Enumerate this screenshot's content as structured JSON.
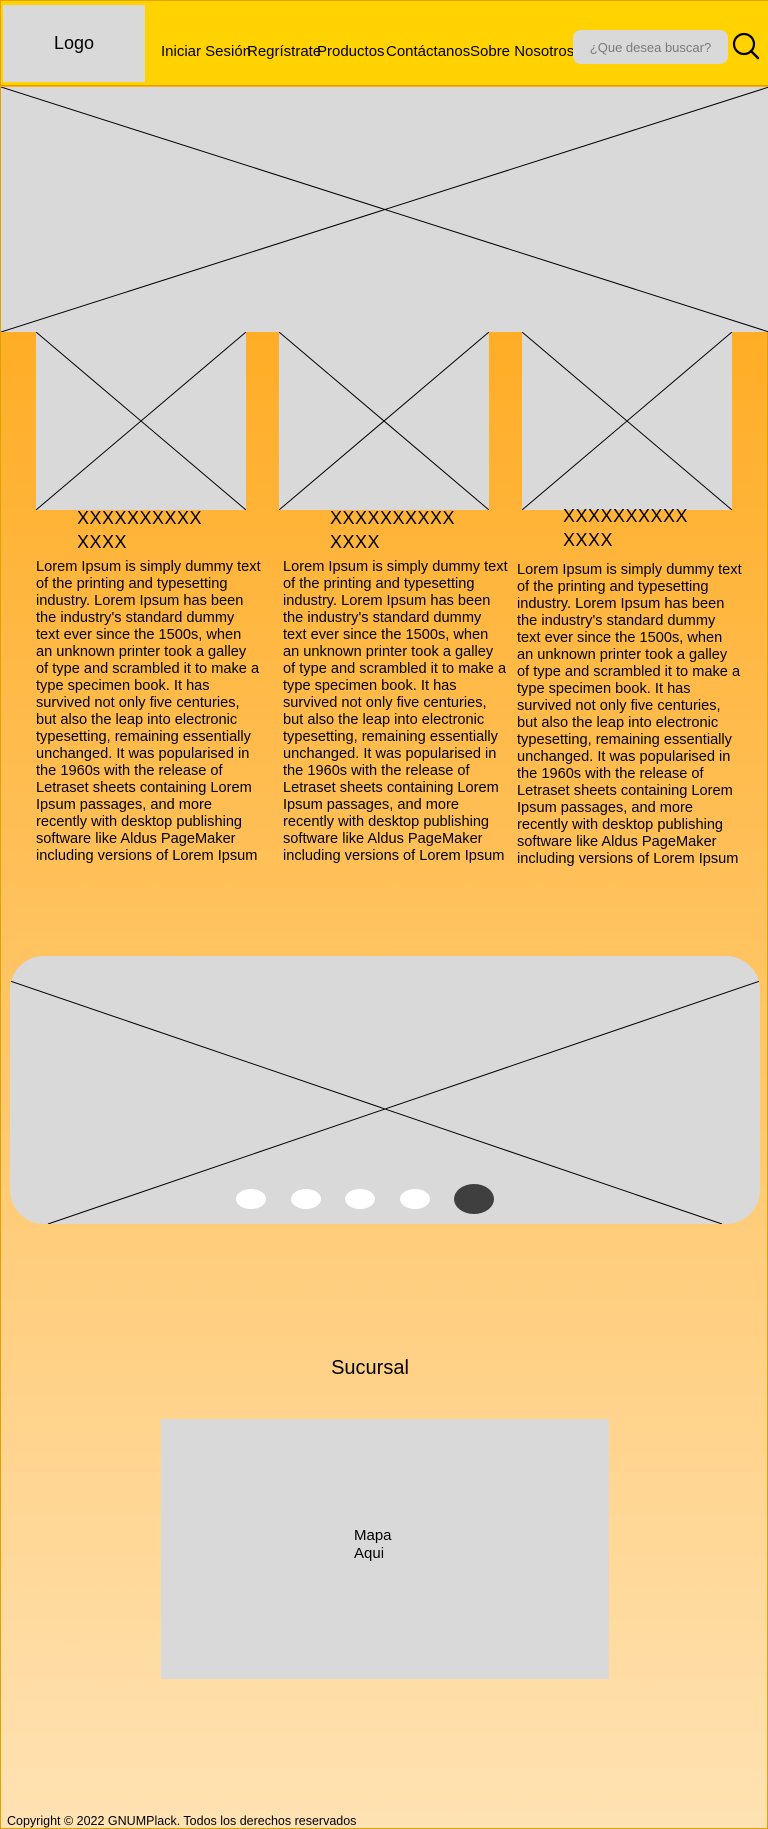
{
  "header": {
    "logo": "Logo",
    "nav": [
      "Iniciar Sesión",
      "Regrístrate",
      "Productos",
      "Contáctanos",
      "Sobre Nosotros"
    ],
    "search_placeholder": "¿Que desea buscar?",
    "search_icon": "search-icon",
    "background_color": "#ffd200"
  },
  "cards": [
    {
      "title_line1": "XXXXXXXXXX",
      "title_line2": "XXXX",
      "text": "Lorem Ipsum is simply dummy text of the printing and typesetting industry. Lorem Ipsum has been the industry's standard dummy text ever since the 1500s, when an unknown printer took a galley of type and scrambled it to make a type specimen book. It has survived not only five centuries, but also the leap into electronic typesetting, remaining essentially unchanged. It was popularised in the 1960s with the release of Letraset sheets containing Lorem Ipsum passages, and more recently with desktop publishing software like Aldus PageMaker including versions of Lorem Ipsum"
    },
    {
      "title_line1": "XXXXXXXXXX",
      "title_line2": "XXXX",
      "text": "Lorem Ipsum is simply dummy text of the printing and typesetting industry. Lorem Ipsum has been the industry's standard dummy text ever since the 1500s, when an unknown printer took a galley of type and scrambled it to make a type specimen book. It has survived not only five centuries, but also the leap into electronic typesetting, remaining essentially unchanged. It was popularised in the 1960s with the release of Letraset sheets containing Lorem Ipsum passages, and more recently with desktop publishing software like Aldus PageMaker including versions of Lorem Ipsum"
    },
    {
      "title_line1": "XXXXXXXXXX",
      "title_line2": "XXXX",
      "text": "Lorem Ipsum is simply dummy text of the printing and typesetting industry. Lorem Ipsum has been the industry's standard dummy text ever since the 1500s, when an unknown printer took a galley of type and scrambled it to make a type specimen book. It has survived not only five centuries, but also the leap into electronic typesetting, remaining essentially unchanged. It was popularised in the 1960s with the release of Letraset sheets containing Lorem Ipsum passages, and more recently with desktop publishing software like Aldus PageMaker including versions of Lorem Ipsum"
    }
  ],
  "carousel": {
    "dots": 5,
    "active_index": 4
  },
  "branch": {
    "title": "Sucursal",
    "map_line1": "Mapa",
    "map_line2": "Aqui"
  },
  "footer": {
    "copyright": "Copyright © 2022 GNUMPlack. Todos los derechos reservados"
  },
  "colors": {
    "placeholder": "#d9d9d9",
    "accent_orange": "#ffad26",
    "active_dot": "#3f3f3f"
  }
}
